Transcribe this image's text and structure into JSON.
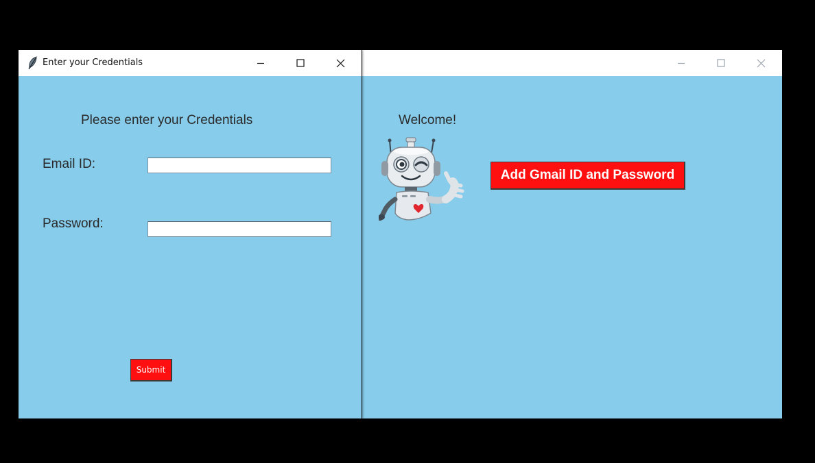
{
  "credentials_window": {
    "title": "Enter your Credentials",
    "heading": "Please enter your Credentials",
    "email_label": "Email ID:",
    "email_value": "",
    "password_label": "Password:",
    "password_value": "",
    "submit_label": "Submit",
    "controls": {
      "minimize": "minimize-icon",
      "maximize": "maximize-icon",
      "close": "close-icon"
    },
    "title_icon": "feather-icon"
  },
  "main_window": {
    "title": "",
    "welcome_text": "Welcome!",
    "add_button_label": "Add Gmail ID and Password",
    "mascot": "robot-waving-illustration",
    "controls": {
      "minimize": "minimize-icon",
      "maximize": "maximize-icon",
      "close": "close-icon"
    }
  },
  "colors": {
    "client_background": "#87cceb",
    "button_red": "#ff1010",
    "desktop_background": "#000000"
  }
}
